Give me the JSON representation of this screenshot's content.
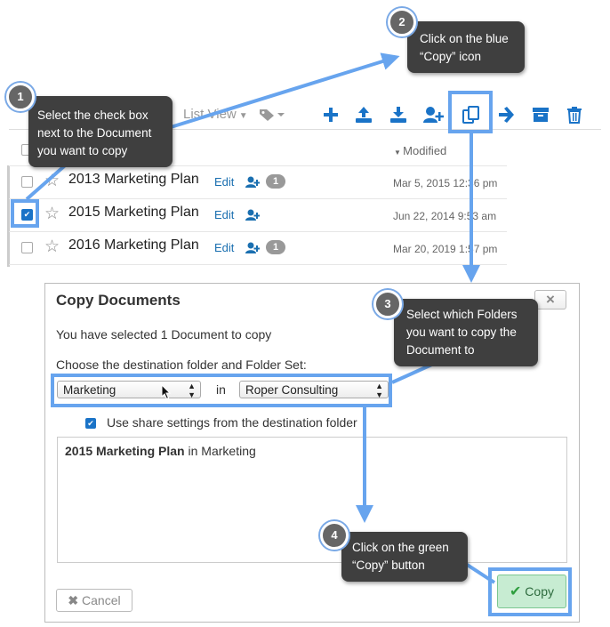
{
  "toolbar": {
    "view_label": "List View",
    "icons": [
      "plus-icon",
      "upload-icon",
      "download-icon",
      "add-user-icon",
      "copy-icon",
      "arrow-right-icon",
      "archive-icon",
      "trash-icon"
    ]
  },
  "list": {
    "sort_header": "Modified",
    "rows": [
      {
        "title": "2013 Marketing Plan",
        "edit": "Edit",
        "badge": "1",
        "date": "Mar 5, 2015 12:36 pm",
        "checked": false
      },
      {
        "title": "2015 Marketing Plan",
        "edit": "Edit",
        "badge": "",
        "date": "Jun 22, 2014 9:53 am",
        "checked": true
      },
      {
        "title": "2016 Marketing Plan",
        "edit": "Edit",
        "badge": "1",
        "date": "Mar 20, 2019 1:57 pm",
        "checked": false
      }
    ]
  },
  "dialog": {
    "title": "Copy Documents",
    "close": "×",
    "selected_text": "You have selected 1 Document to copy",
    "choose_label": "Choose the destination folder and Folder Set:",
    "folder_value": "Marketing",
    "in_label": "in",
    "folder_set_value": "Roper Consulting",
    "share_label": "Use share settings from the destination folder",
    "share_checked": true,
    "preview_doc": "2015 Marketing Plan",
    "preview_in": " in Marketing",
    "cancel_label": "Cancel",
    "copy_label": "Copy"
  },
  "callouts": [
    {
      "num": "1",
      "text": "Select the check box next to the Document you want to copy"
    },
    {
      "num": "2",
      "text": "Click on the blue “Copy” icon"
    },
    {
      "num": "3",
      "text": "Select which Folders you want to copy the Document to"
    },
    {
      "num": "4",
      "text": "Click on the green “Copy” button"
    }
  ],
  "colors": {
    "accent_blue": "#1a73c7",
    "highlight": "#67a4ee",
    "copy_green": "#2e9e3e",
    "callout_bg": "#3f3f3f"
  }
}
